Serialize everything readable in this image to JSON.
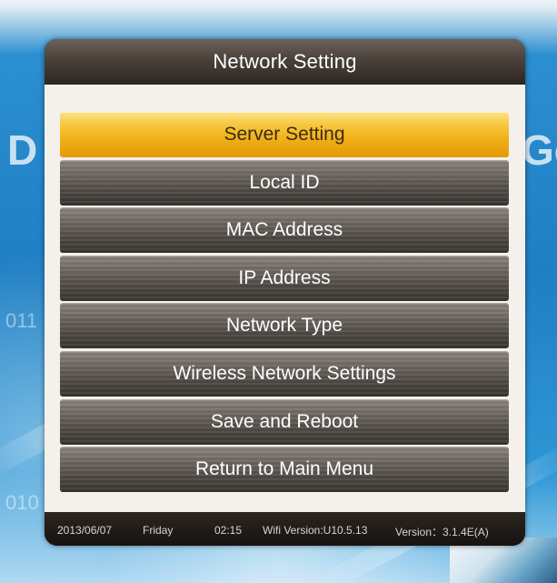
{
  "dialog": {
    "title": "Network Setting"
  },
  "menu": {
    "selected_index": 0,
    "items": [
      {
        "label": "Server Setting"
      },
      {
        "label": "Local ID"
      },
      {
        "label": "MAC Address"
      },
      {
        "label": "IP Address"
      },
      {
        "label": "Network Type"
      },
      {
        "label": "Wireless Network Settings"
      },
      {
        "label": "Save and Reboot"
      },
      {
        "label": "Return to Main Menu"
      }
    ]
  },
  "status_bar": {
    "date": "2013/06/07",
    "day": "Friday",
    "time": "02:15",
    "wifi_version": "Wifi Version:U10.5.13",
    "version": "Version：3.1.4E(A)"
  },
  "background": {
    "left_letter": "D",
    "right_letters": "Gc",
    "left_numbers_top": "011",
    "left_numbers_bottom": "010"
  },
  "colors": {
    "selected_highlight": "#F0B020",
    "menu_item": "#5E5751",
    "dialog_frame": "#1C1814",
    "dialog_body": "#F4F1EC",
    "screen_background": "#1F86C9"
  }
}
